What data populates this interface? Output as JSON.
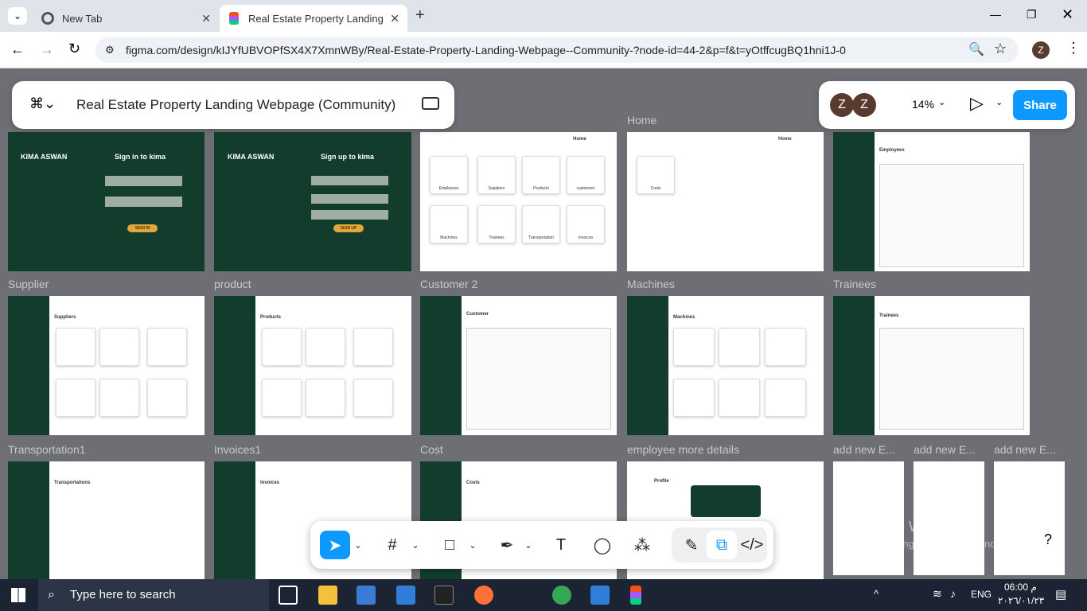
{
  "browser": {
    "tabs": [
      {
        "label": "New Tab"
      },
      {
        "label": "Real Estate Property Landing W"
      }
    ],
    "new_tab": "+",
    "url": "figma.com/design/kIJYfUBVOPfSX4X7XmnWBy/Real-Estate-Property-Landing-Webpage--Community-?node-id=44-2&p=f&t=yOtffcugBQ1hni1J-0",
    "profile": "Z"
  },
  "figma": {
    "file_title": "Real Estate Property Landing Webpage (Community)",
    "zoom": "14%",
    "share": "Share",
    "avatars": [
      "Z",
      "Z"
    ],
    "help": "?"
  },
  "frames": {
    "row1": [
      {
        "label": "",
        "title": "Sign in to kima",
        "button": "SIGN IN",
        "logo": "KIMA ASWAN"
      },
      {
        "label": "",
        "title": "Sign up to kima",
        "button": "SIGN UP",
        "logo": "KIMA ASWAN"
      },
      {
        "label": "",
        "cards": [
          "Employees",
          "Suppliers",
          "Products",
          "customers",
          "Machines",
          "Trainees",
          "Transportation",
          "Invoices"
        ]
      },
      {
        "label": "Home",
        "cards": [
          "Costs"
        ]
      },
      {
        "label": "",
        "heading": "Employees"
      }
    ],
    "row2": [
      {
        "label": "Supplier",
        "heading": "Suppliers"
      },
      {
        "label": "product",
        "heading": "Products"
      },
      {
        "label": "Customer 2",
        "heading": "Customer"
      },
      {
        "label": "Machines",
        "heading": "Machines"
      },
      {
        "label": "Trainees",
        "heading": "Trainees"
      }
    ],
    "row3": [
      {
        "label": "Transportation1",
        "heading": "Transportations"
      },
      {
        "label": "Invoices1",
        "heading": "Invoices"
      },
      {
        "label": "Cost",
        "heading": "Costs"
      },
      {
        "label": "employee more details",
        "heading": "Profile"
      },
      {
        "label": "add new E..."
      },
      {
        "label": "add new E..."
      },
      {
        "label": "add new E..."
      }
    ],
    "nav_home": "Home"
  },
  "windows_watermark": {
    "title": "Activate Windows",
    "subtitle": "Go to Settings to activate Windows."
  },
  "taskbar": {
    "search_placeholder": "Type here to search",
    "lang": "ENG",
    "time": "06:00 م",
    "date": "٢٠٢٦/٠١/٢٣"
  }
}
